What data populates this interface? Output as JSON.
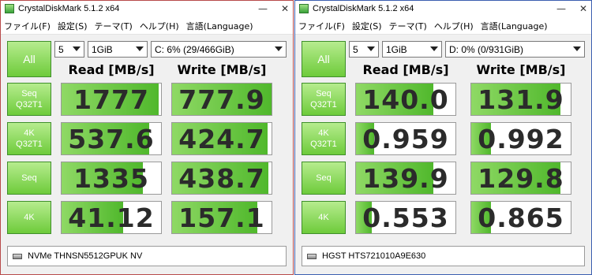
{
  "windows": [
    {
      "title": "CrystalDiskMark 5.1.2 x64",
      "menu": [
        "ファイル(F)",
        "設定(S)",
        "テーマ(T)",
        "ヘルプ(H)",
        "言語(Language)"
      ],
      "all_label": "All",
      "count": "5",
      "size": "1GiB",
      "drive": "C: 6% (29/466GiB)",
      "read_header": "Read [MB/s]",
      "write_header": "Write [MB/s]",
      "tests": [
        {
          "label": "Seq\nQ32T1",
          "read": "1777",
          "write": "777.9",
          "read_fill": 0.98,
          "write_fill": 1.0
        },
        {
          "label": "4K\nQ32T1",
          "read": "537.6",
          "write": "424.7",
          "read_fill": 0.88,
          "write_fill": 0.96
        },
        {
          "label": "Seq",
          "read": "1335",
          "write": "438.7",
          "read_fill": 0.82,
          "write_fill": 0.97
        },
        {
          "label": "4K",
          "read": "41.12",
          "write": "157.1",
          "read_fill": 0.62,
          "write_fill": 0.86
        }
      ],
      "status": "NVMe THNSN5512GPUK NV"
    },
    {
      "title": "CrystalDiskMark 5.1.2 x64",
      "menu": [
        "ファイル(F)",
        "設定(S)",
        "テーマ(T)",
        "ヘルプ(H)",
        "言語(Language)"
      ],
      "all_label": "All",
      "count": "5",
      "size": "1GiB",
      "drive": "D: 0% (0/931GiB)",
      "read_header": "Read [MB/s]",
      "write_header": "Write [MB/s]",
      "tests": [
        {
          "label": "Seq\nQ32T1",
          "read": "140.0",
          "write": "131.9",
          "read_fill": 0.78,
          "write_fill": 0.9
        },
        {
          "label": "4K\nQ32T1",
          "read": "0.959",
          "write": "0.992",
          "read_fill": 0.18,
          "write_fill": 0.2
        },
        {
          "label": "Seq",
          "read": "139.9",
          "write": "129.8",
          "read_fill": 0.78,
          "write_fill": 0.9
        },
        {
          "label": "4K",
          "read": "0.553",
          "write": "0.865",
          "read_fill": 0.16,
          "write_fill": 0.2
        }
      ],
      "status": "HGST HTS721010A9E630"
    }
  ]
}
